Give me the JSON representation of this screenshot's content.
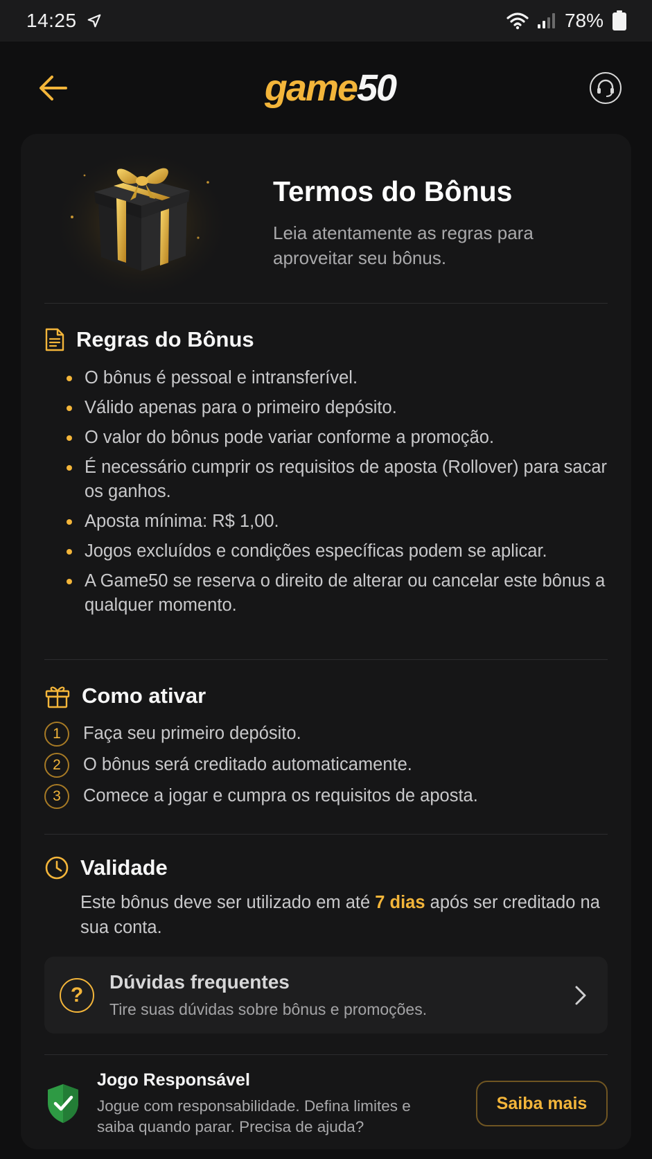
{
  "status_bar": {
    "time": "14:25",
    "battery": "78%"
  },
  "header": {
    "logo_game": "game",
    "logo_num": "50"
  },
  "hero": {
    "title": "Termos do Bônus",
    "subtitle": "Leia atentamente as regras para aproveitar seu bônus."
  },
  "rules": {
    "title": "Regras do Bônus",
    "items": [
      "O bônus é pessoal e intransferível.",
      "Válido apenas para o primeiro depósito.",
      "O valor do bônus pode variar conforme a promoção.",
      "É necessário cumprir os requisitos de aposta (Rollover) para sacar os ganhos.",
      "Aposta mínima: R$ 1,00.",
      "Jogos excluídos e condições específicas podem se aplicar.",
      "A Game50 se reserva o direito de alterar ou cancelar este bônus a qualquer momento."
    ]
  },
  "activate": {
    "title": "Como ativar",
    "steps": [
      {
        "num": "1",
        "text": "Faça seu primeiro depósito."
      },
      {
        "num": "2",
        "text": "O bônus será creditado automaticamente."
      },
      {
        "num": "3",
        "text": "Comece a jogar e cumpra os requisitos de aposta."
      }
    ]
  },
  "validity": {
    "title": "Validade",
    "text_before": "Este bônus deve ser utilizado em até ",
    "highlight": "7 dias",
    "text_after": " após ser creditado na sua conta."
  },
  "faq": {
    "icon": "?",
    "title": "Dúvidas frequentes",
    "subtitle": "Tire suas dúvidas sobre bônus e promoções."
  },
  "responsible": {
    "title": "Jogo Responsável",
    "text": "Jogue com responsabilidade. Defina limites e saiba quando parar. Precisa de ajuda?",
    "button": "Saiba mais"
  },
  "colors": {
    "accent": "#f3b53a",
    "background": "#0f0f10",
    "card": "#161617",
    "shield": "#2e9a44"
  }
}
